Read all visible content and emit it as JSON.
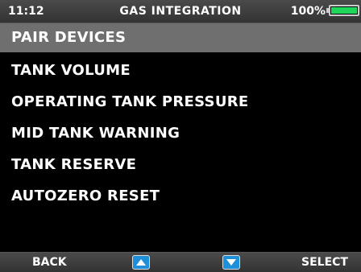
{
  "status": {
    "time": "11:12",
    "title": "GAS INTEGRATION",
    "battery": "100%",
    "battery_level": 1.0,
    "battery_color": "#1fd65a"
  },
  "menu": {
    "items": [
      {
        "label": "PAIR DEVICES"
      },
      {
        "label": "TANK VOLUME"
      },
      {
        "label": "OPERATING TANK PRESSURE"
      },
      {
        "label": "MID TANK WARNING"
      },
      {
        "label": "TANK RESERVE"
      },
      {
        "label": "AUTOZERO RESET"
      }
    ],
    "selected_index": 0,
    "highlight_color": "#6f6f6f"
  },
  "softkeys": {
    "back": "BACK",
    "up_icon": "up-arrow-icon",
    "down_icon": "down-arrow-icon",
    "select": "SELECT",
    "arrow_color": "#1e8fd8"
  }
}
